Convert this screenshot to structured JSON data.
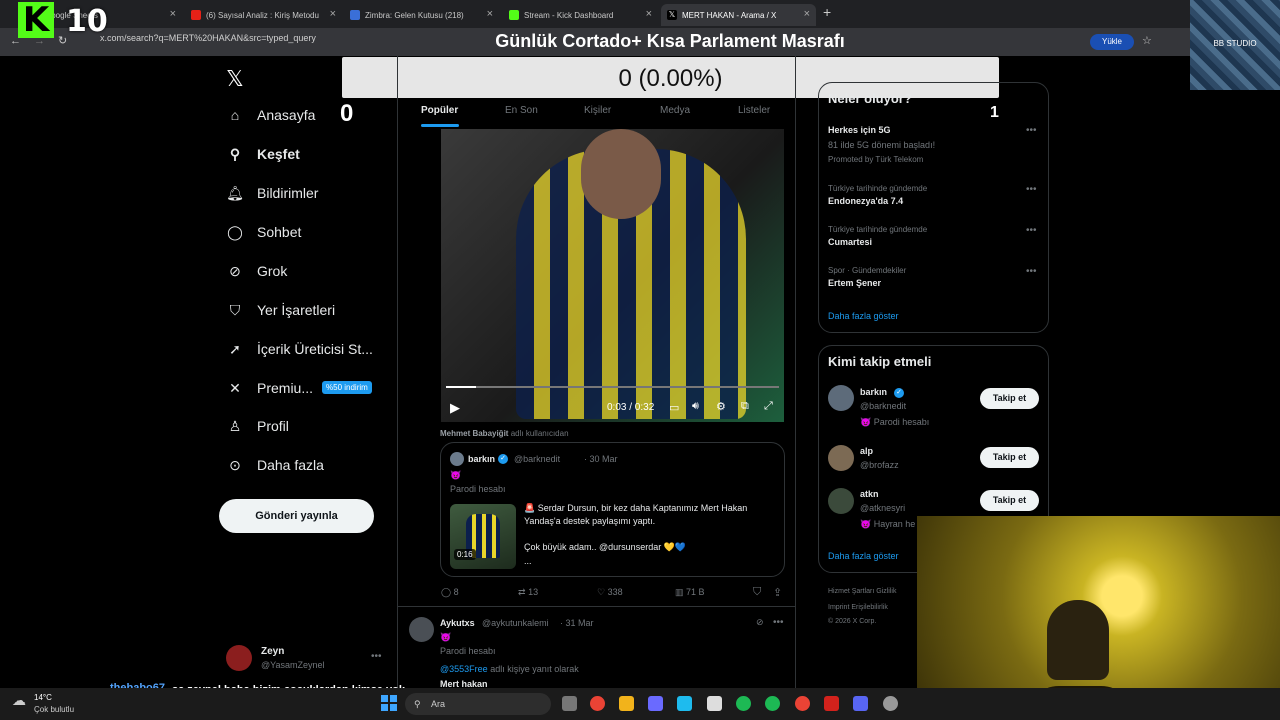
{
  "browser": {
    "tabs": [
      {
        "label": "Google Sheets"
      },
      {
        "label": "(6) Sayısal Analiz : Kiriş Metodu"
      },
      {
        "label": "Zimbra: Gelen Kutusu (218)"
      },
      {
        "label": "Stream - Kick Dashboard"
      },
      {
        "label": "MERT HAKAN - Arama / X"
      }
    ],
    "url": "x.com/search?q=MERT%20HAKAN&src=typed_query",
    "install_label": "Yükle"
  },
  "overlay": {
    "kick_count": "10",
    "title": "Günlük Cortado+ Kısa Parlament Masrafı",
    "goal": "0 (0.00%)",
    "goal_progress": 0,
    "studio": "BB STUDIO",
    "counter_left": "0",
    "counter_right": "1"
  },
  "nav": {
    "items": [
      {
        "label": "Anasayfa",
        "icon": "home-icon"
      },
      {
        "label": "Keşfet",
        "icon": "search-icon"
      },
      {
        "label": "Bildirimler",
        "icon": "bell-icon"
      },
      {
        "label": "Sohbet",
        "icon": "chat-icon"
      },
      {
        "label": "Grok",
        "icon": "grok-icon"
      },
      {
        "label": "Yer İşaretleri",
        "icon": "bookmark-icon"
      },
      {
        "label": "İçerik Üreticisi St...",
        "icon": "rocket-icon"
      },
      {
        "label": "Premiu...",
        "icon": "x-icon"
      },
      {
        "label": "Profil",
        "icon": "person-icon"
      },
      {
        "label": "Daha fazla",
        "icon": "more-icon"
      }
    ],
    "premium_badge": "%50 indirim",
    "post_button": "Gönderi yayınla",
    "account": {
      "name": "Zeyn",
      "handle": "@YasamZeynel"
    }
  },
  "search_tabs": [
    "Popüler",
    "En Son",
    "Kişiler",
    "Medya",
    "Listeler"
  ],
  "video": {
    "time": "0:03 / 0:32",
    "progress": 0.09
  },
  "reposted": {
    "name": "Mehmet Babayiğit",
    "suffix": "adlı kullanıcıdan"
  },
  "quoted": {
    "name": "barkın",
    "handle": "@barknedit",
    "date": "30 Mar",
    "emoji": "😈",
    "label": "Parodi hesabı",
    "text1": "🚨 Serdar Dursun, bir kez daha Kaptanımız Mert Hakan Yandaş'a destek paylaşımı yaptı.",
    "text2": "Çok büyük adam.. @dursunserdar 💛💙",
    "ellipsis": "...",
    "thumb_time": "0:16"
  },
  "actions": {
    "replies": "8",
    "reposts": "13",
    "likes": "338",
    "views": "71 B"
  },
  "tweet2": {
    "name": "Aykutxs",
    "handle": "@aykutunkalemi",
    "date": "31 Mar",
    "emoji": "😈",
    "label": "Parodi hesabı",
    "reply_to": "@3553Free",
    "reply_suffix": "adlı kişiye yanıt olarak",
    "text": "Mert hakan"
  },
  "trends": {
    "title": "Neler oluyor?",
    "items": [
      {
        "name": "Herkes için 5G",
        "sub": "81 ilde 5G dönemi başladı!",
        "promo": "Promoted by Türk Telekom"
      },
      {
        "context": "Türkiye tarihinde gündemde",
        "name": "Endonezya'da 7.4"
      },
      {
        "context": "Türkiye tarihinde gündemde",
        "name": "Cumartesi"
      },
      {
        "context": "Spor · Gündemdekiler",
        "name": "Ertem Şener"
      }
    ],
    "more": "Daha fazla göster"
  },
  "who_to_follow": {
    "title": "Kimi takip etmeli",
    "users": [
      {
        "name": "barkın",
        "handle": "@barknedit",
        "note": "😈 Parodi hesabı"
      },
      {
        "name": "alp",
        "handle": "@brofazz",
        "note": ""
      },
      {
        "name": "atkn",
        "handle": "@atknesyri",
        "note": "😈 Hayran he"
      }
    ],
    "follow_label": "Takip et",
    "more": "Daha fazla göster"
  },
  "footer": {
    "line1": "Hizmet Şartları   Gizlilik",
    "line2": "Imprint   Erişilebilirlik",
    "line3": "© 2026 X Corp."
  },
  "chat": {
    "user": "thebabo67",
    "message": "sa zeynel baba bizim çocuklardan kimse yok gibi"
  },
  "taskbar": {
    "temp": "14°C",
    "weather": "Çok bulutlu",
    "search": "Ara"
  }
}
